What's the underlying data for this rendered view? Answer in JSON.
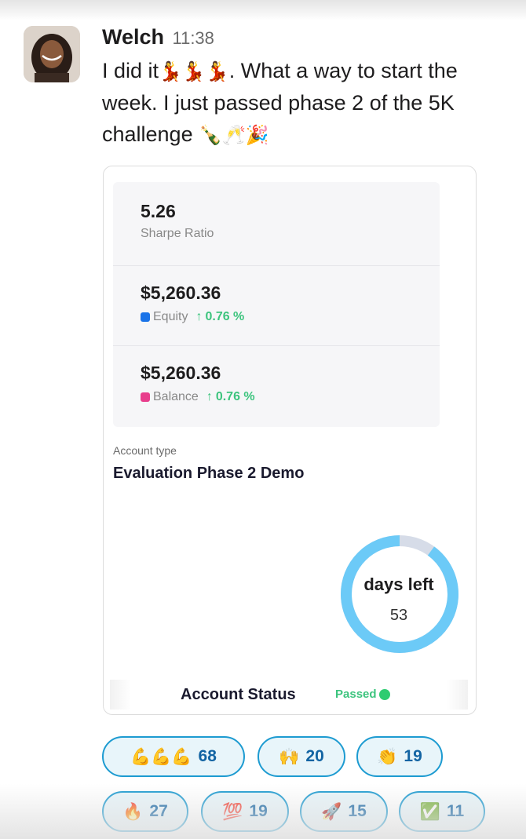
{
  "message": {
    "username": "Welch",
    "timestamp": "11:38",
    "text_1": "I did it",
    "emoji_1": "💃💃💃",
    "text_2": ". What a way to start the week. I just passed phase 2 of the 5K challenge",
    "emoji_2": "🍾🥂🎉"
  },
  "card": {
    "sharpe": {
      "value": "5.26",
      "label": "Sharpe Ratio"
    },
    "equity": {
      "value": "$5,260.36",
      "label": "Equity",
      "arrow": "↑",
      "change": "0.76 %",
      "color": "#1a73e8"
    },
    "balance": {
      "value": "$5,260.36",
      "label": "Balance",
      "arrow": "↑",
      "change": "0.76 %",
      "color": "#e83e8c"
    },
    "account_type_label": "Account type",
    "account_type": "Evaluation Phase 2 Demo",
    "days_left": {
      "title": "days left",
      "value": "53",
      "progress_fraction": 0.9,
      "ring_color": "#6ccaf7",
      "track_color": "#d6dce8"
    },
    "status": {
      "label": "Account Status",
      "value": "Passed",
      "color": "#3dc47e"
    }
  },
  "reactions": [
    {
      "emoji": "💪💪💪",
      "count": "68"
    },
    {
      "emoji": "🙌",
      "count": "20"
    },
    {
      "emoji": "👏",
      "count": "19"
    },
    {
      "emoji": "🔥",
      "count": "27"
    },
    {
      "emoji": "💯",
      "count": "19"
    },
    {
      "emoji": "🚀",
      "count": "15"
    },
    {
      "emoji": "✅",
      "count": "11"
    }
  ]
}
